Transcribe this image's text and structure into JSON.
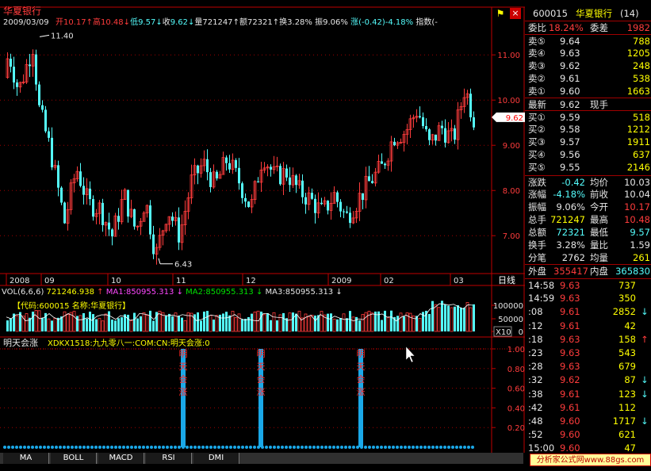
{
  "colors": {
    "up": "#ff3c3c",
    "down": "#54fcfc",
    "grid": "#a00000",
    "axis": "#c00000"
  },
  "header": {
    "name": "华夏银行",
    "date": "2009/03/09",
    "open_label": "开",
    "open": "10.17",
    "high_label": "高",
    "high": "10.48",
    "low_label": "低",
    "low": "9.57",
    "close_label": "收",
    "close": "9.62",
    "vol_label": "量",
    "vol": "721247",
    "amt_label": "额",
    "amt": "72321",
    "turn_label": "换",
    "turn": "3.28%",
    "amp_label": "振",
    "amp": "9.06%",
    "chg_label": "涨",
    "chg": "(-0.42)-4.18%",
    "idx_label": "指数",
    "idx": "(-",
    "flag_icon": "flag-icon",
    "close_icon": "close-icon",
    "close_glyph": "×"
  },
  "price_axis": {
    "ticks": [
      "11.00",
      "10.00",
      "9.00",
      "8.00",
      "7.00"
    ],
    "current": "9.62"
  },
  "annotations": {
    "high": "11.40",
    "low": "6.43"
  },
  "date_axis": {
    "labels": [
      "2008",
      "09",
      "10",
      "11",
      "12",
      "2009",
      "02",
      "03"
    ],
    "unit": "日线"
  },
  "volume": {
    "title": "VOL(6,6,6)",
    "value": "721246.938",
    "ma1": "MA1:850955.313",
    "ma2": "MA2:850955.313",
    "ma3": "MA3:850955.313",
    "code_box": "【代码:600015 名称:华夏银行】",
    "ticks": [
      "100000",
      "50000",
      "0"
    ],
    "unit": "X10"
  },
  "indicator": {
    "title": "明天会涨",
    "formula": "XDKX1518:九九零八一:COM:CN:明天会涨:0",
    "ticks": [
      "1.00",
      "0.80",
      "0.60",
      "0.40",
      "0.20"
    ],
    "signal_text": "明天会涨"
  },
  "tabs": [
    "MA",
    "BOLL",
    "MACD",
    "RSI",
    "DMI"
  ],
  "quote": {
    "code": "600015",
    "name": "华夏银行",
    "rank": "(14)",
    "weibi_label": "委比",
    "weibi": "18.24%",
    "weicha_label": "委差",
    "weicha": "1982",
    "asks": [
      {
        "l": "卖⑤",
        "p": "9.64",
        "v": "788"
      },
      {
        "l": "卖④",
        "p": "9.63",
        "v": "1205"
      },
      {
        "l": "卖③",
        "p": "9.62",
        "v": "248"
      },
      {
        "l": "卖②",
        "p": "9.61",
        "v": "538"
      },
      {
        "l": "卖①",
        "p": "9.60",
        "v": "1663"
      }
    ],
    "last_label": "最新",
    "last": "9.62",
    "now_label": "现手",
    "bids": [
      {
        "l": "买①",
        "p": "9.59",
        "v": "518"
      },
      {
        "l": "买②",
        "p": "9.58",
        "v": "1212"
      },
      {
        "l": "买③",
        "p": "9.57",
        "v": "1911"
      },
      {
        "l": "买④",
        "p": "9.56",
        "v": "637"
      },
      {
        "l": "买⑤",
        "p": "9.55",
        "v": "2146"
      }
    ],
    "stats": [
      {
        "l1": "涨跌",
        "v1": "-0.42",
        "l2": "均价",
        "v2": "10.03"
      },
      {
        "l1": "涨幅",
        "v1": "-4.18%",
        "l2": "前收",
        "v2": "10.04"
      },
      {
        "l1": "振幅",
        "v1": "9.06%",
        "l2": "今开",
        "v2": "10.17"
      },
      {
        "l1": "总手",
        "v1": "721247",
        "l2": "最高",
        "v2": "10.48"
      },
      {
        "l1": "总额",
        "v1": "72321",
        "l2": "最低",
        "v2": "9.57"
      },
      {
        "l1": "换手",
        "v1": "3.28%",
        "l2": "量比",
        "v2": "1.59"
      },
      {
        "l1": "分笔",
        "v1": "2762",
        "l2": "均量",
        "v2": "261"
      }
    ],
    "outer_label": "外盘",
    "outer": "355417",
    "inner_label": "内盘",
    "inner": "365830",
    "ticks": [
      {
        "t": "14:58",
        "p": "9.63",
        "v": "737",
        "a": ""
      },
      {
        "t": "14:59",
        "p": "9.63",
        "v": "350",
        "a": ""
      },
      {
        "t": ":08",
        "p": "9.61",
        "v": "2852",
        "a": "↓"
      },
      {
        "t": ":12",
        "p": "9.61",
        "v": "42",
        "a": ""
      },
      {
        "t": ":18",
        "p": "9.63",
        "v": "158",
        "a": "↑"
      },
      {
        "t": ":23",
        "p": "9.63",
        "v": "543",
        "a": ""
      },
      {
        "t": ":28",
        "p": "9.63",
        "v": "679",
        "a": ""
      },
      {
        "t": ":32",
        "p": "9.62",
        "v": "87",
        "a": "↓"
      },
      {
        "t": ":38",
        "p": "9.61",
        "v": "123",
        "a": "↓"
      },
      {
        "t": ":42",
        "p": "9.61",
        "v": "112",
        "a": ""
      },
      {
        "t": ":48",
        "p": "9.60",
        "v": "1717",
        "a": "↓"
      },
      {
        "t": ":52",
        "p": "9.60",
        "v": "621",
        "a": ""
      },
      {
        "t": "15:00",
        "p": "9.60",
        "v": "47",
        "a": ""
      }
    ]
  },
  "watermark": "分析家公式网www.88gs.com"
}
